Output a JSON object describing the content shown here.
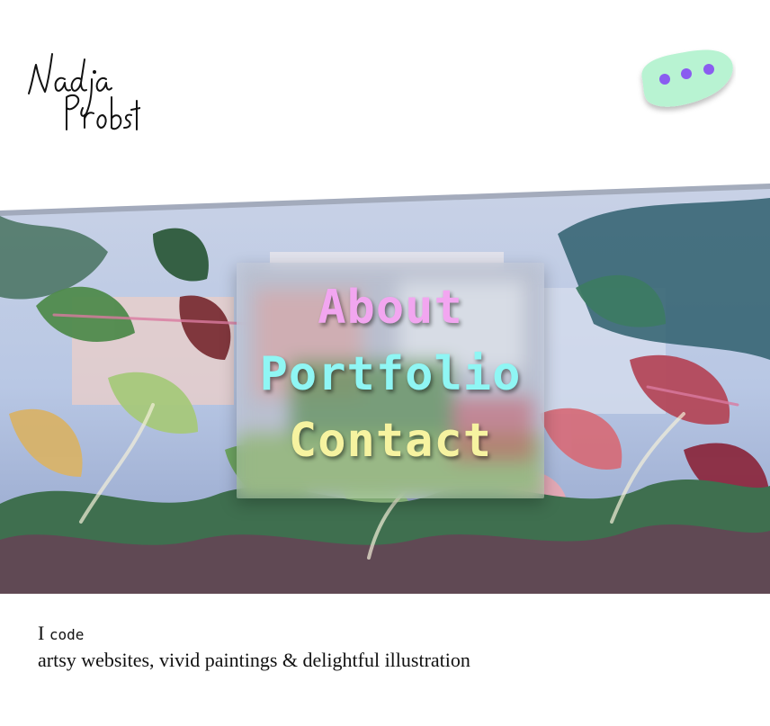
{
  "logo": {
    "line1": "Nadja",
    "line2": "Probst"
  },
  "menu": {
    "icon": "more-dots-icon",
    "colors": {
      "blob": "#b8f3d2",
      "dots": "#8a5cf0"
    }
  },
  "nav": {
    "links": [
      {
        "label": "About",
        "color": "#f2a6f0"
      },
      {
        "label": "Portfolio",
        "color": "#8ff6f4"
      },
      {
        "label": "Contact",
        "color": "#f6f3a0"
      }
    ]
  },
  "intro": {
    "prefix": "I",
    "verb": "code",
    "rest": "artsy websites, vivid paintings & delightful illustration"
  }
}
